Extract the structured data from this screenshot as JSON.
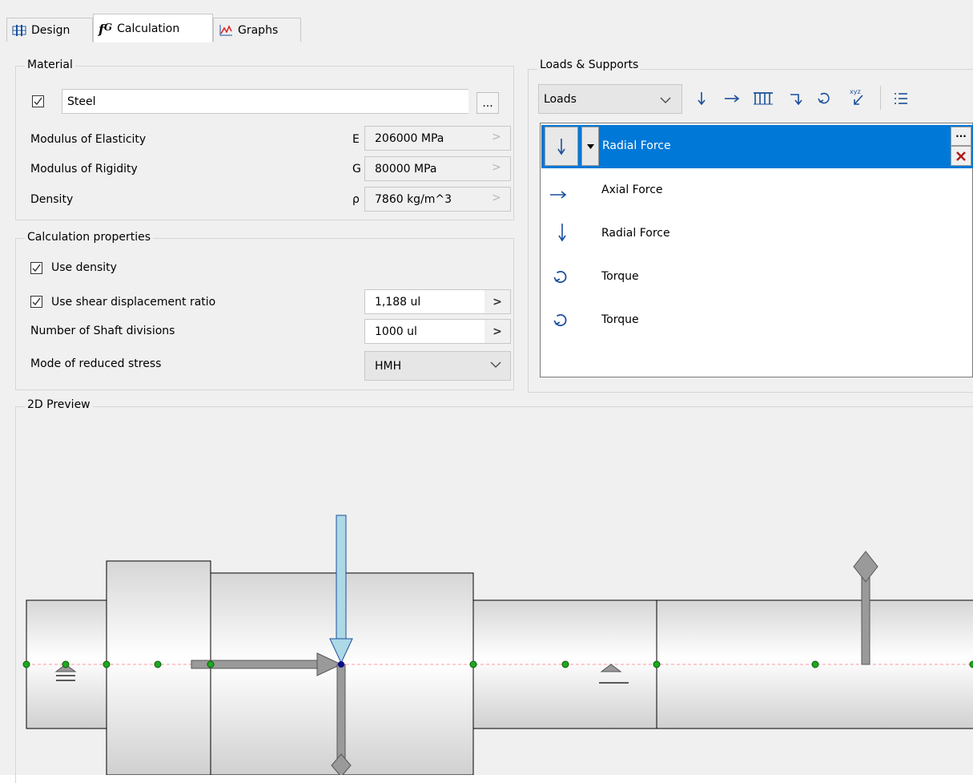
{
  "tabs": [
    {
      "label": "Design",
      "icon": "design-grid-icon"
    },
    {
      "label": "Calculation",
      "icon": "fx-icon"
    },
    {
      "label": "Graphs",
      "icon": "graph-icon"
    }
  ],
  "material": {
    "legend": "Material",
    "checked": true,
    "name": "Steel",
    "browse_label": "...",
    "rows": [
      {
        "label": "Modulus of Elasticity",
        "symbol": "E",
        "value": "206000 MPa"
      },
      {
        "label": "Modulus of Rigidity",
        "symbol": "G",
        "value": "80000 MPa"
      },
      {
        "label": "Density",
        "symbol": "ρ",
        "value": "7860 kg/m^3"
      }
    ]
  },
  "calc": {
    "legend": "Calculation properties",
    "use_density": {
      "label": "Use density",
      "checked": true
    },
    "shear": {
      "label": "Use shear displacement ratio",
      "checked": true,
      "value": "1,188 ul"
    },
    "divisions": {
      "label": "Number of Shaft divisions",
      "value": "1000 ul"
    },
    "stress": {
      "label": "Mode of reduced stress",
      "value": "HMH"
    }
  },
  "loads": {
    "legend": "Loads & Supports",
    "dropdown": "Loads",
    "toolbar": [
      "radial-force-icon",
      "axial-force-icon",
      "continuous-load-icon",
      "bending-moment-icon",
      "torque-icon",
      "user-coordinates-icon",
      "list-icon"
    ],
    "selected": "Radial Force",
    "items": [
      {
        "label": "Axial Force",
        "icon": "axial-force-icon"
      },
      {
        "label": "Radial Force",
        "icon": "radial-force-icon"
      },
      {
        "label": "Torque",
        "icon": "torque-icon"
      },
      {
        "label": "Torque",
        "icon": "torque-icon"
      }
    ],
    "colors": {
      "selected": "#0078d7",
      "icon": "#1a4f9c"
    }
  },
  "preview": {
    "legend": "2D Preview"
  }
}
